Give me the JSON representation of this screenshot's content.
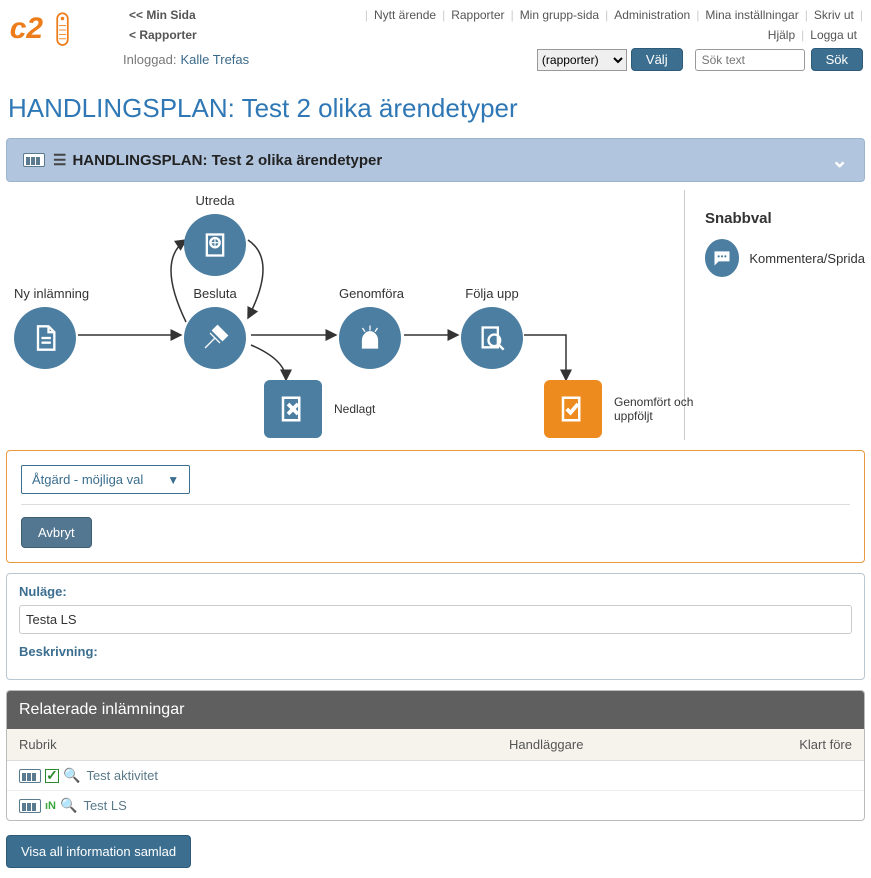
{
  "nav": {
    "min_sida": "<< Min Sida",
    "rapporter_back": "< Rapporter",
    "items": [
      "Nytt ärende",
      "Rapporter",
      "Min grupp-sida",
      "Administration",
      "Mina inställningar",
      "Skriv ut"
    ],
    "help": "Hjälp",
    "logout": "Logga ut"
  },
  "login": {
    "label": "Inloggad:",
    "user": "Kalle Trefas",
    "select_value": "(rapporter)",
    "valj": "Välj",
    "search_placeholder": "Sök text",
    "sok": "Sök"
  },
  "page_title": "HANDLINGSPLAN: Test 2 olika ärendetyper",
  "panel_title": "HANDLINGSPLAN: Test 2 olika ärendetyper",
  "workflow": {
    "ny": "Ny inlämning",
    "utreda": "Utreda",
    "besluta": "Besluta",
    "genomfora": "Genomföra",
    "folja": "Följa upp",
    "nedlagt": "Nedlagt",
    "genomfort": "Genomfört och uppföljt"
  },
  "snabbval": {
    "title": "Snabbval",
    "item1": "Kommentera/Sprida"
  },
  "action": {
    "dropdown": "Åtgärd - möjliga val",
    "avbryt": "Avbryt"
  },
  "info": {
    "nulage_label": "Nuläge:",
    "nulage_value": "Testa LS",
    "beskrivning_label": "Beskrivning:"
  },
  "related": {
    "header": "Relaterade inlämningar",
    "cols": {
      "rubrik": "Rubrik",
      "handlaggare": "Handläggare",
      "klart": "Klart före"
    },
    "rows": [
      {
        "title": "Test aktivitet",
        "status": "check"
      },
      {
        "title": "Test LS",
        "status": "in"
      }
    ]
  },
  "btn_full": "Visa all information samlad"
}
